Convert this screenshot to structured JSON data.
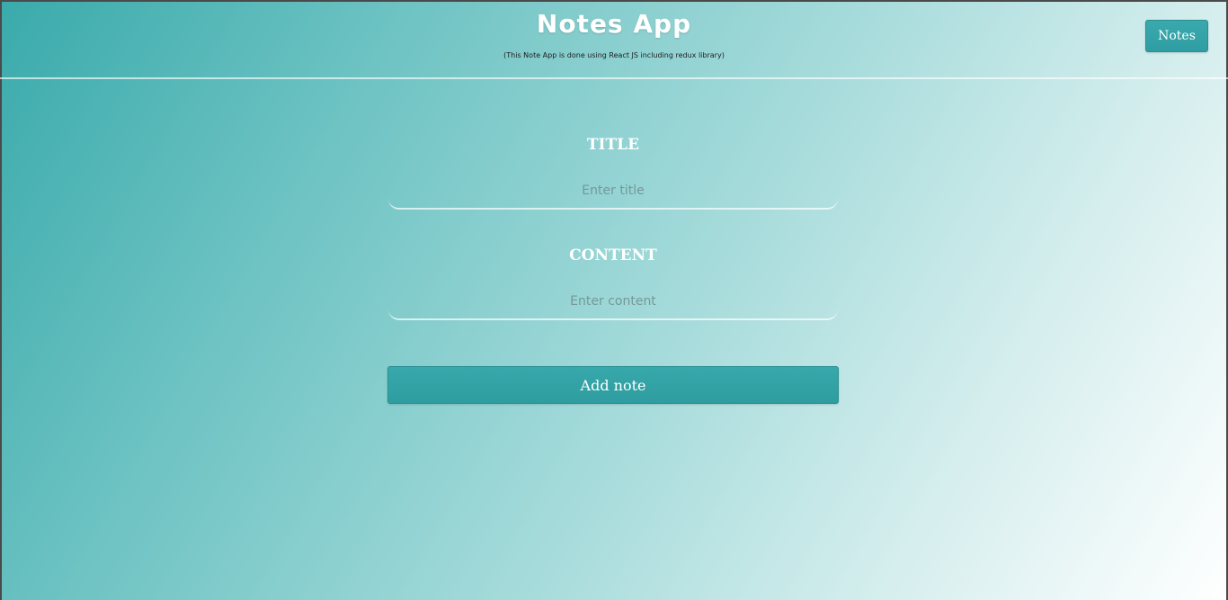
{
  "header": {
    "title": "Notes App",
    "subtitle": "(This Note App is done using React JS including redux library)",
    "notes_button_label": "Notes"
  },
  "form": {
    "title_label": "TITLE",
    "title_value": "",
    "title_placeholder": "Enter title",
    "content_label": "CONTENT",
    "content_value": "",
    "content_placeholder": "Enter content",
    "submit_label": "Add note"
  },
  "colors": {
    "accent": "#33a4a7",
    "gradient_start": "#3aaaab",
    "gradient_end": "#ffffff",
    "text_light": "#ffffff"
  }
}
